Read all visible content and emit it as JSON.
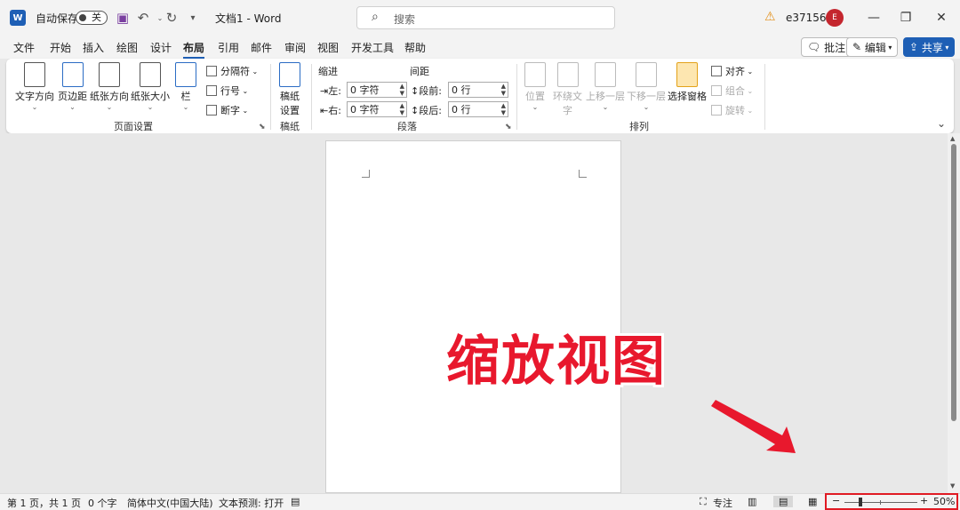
{
  "titlebar": {
    "autosave_label": "自动保存",
    "autosave_state": "关",
    "doc_title": "文档1 - Word",
    "search_placeholder": "搜索",
    "username": "e37156",
    "avatar_initial": "E"
  },
  "menu": [
    "文件",
    "开始",
    "插入",
    "绘图",
    "设计",
    "布局",
    "引用",
    "邮件",
    "审阅",
    "视图",
    "开发工具",
    "帮助"
  ],
  "menu_active": "布局",
  "right_buttons": {
    "comment": "批注",
    "edit": "编辑",
    "share": "共享"
  },
  "ribbon": {
    "page_setup": {
      "buttons": [
        "文字方向",
        "页边距",
        "纸张方向",
        "纸张大小",
        "栏"
      ],
      "small": [
        "分隔符",
        "行号",
        "断字"
      ],
      "label": "页面设置"
    },
    "draft": {
      "button_line1": "稿纸",
      "button_line2": "设置",
      "label": "稿纸"
    },
    "paragraph": {
      "indent_title": "缩进",
      "spacing_title": "间距",
      "left_label": "左:",
      "right_label": "右:",
      "left_value": "0 字符",
      "right_value": "0 字符",
      "before_label": "段前:",
      "after_label": "段后:",
      "before_value": "0 行",
      "after_value": "0 行",
      "label": "段落"
    },
    "arrange": {
      "position": "位置",
      "wrap_line1": "环绕文",
      "wrap_line2": "字",
      "forward": "上移一层",
      "backward": "下移一层",
      "pane": "选择窗格",
      "align": "对齐",
      "group": "组合",
      "rotate": "旋转",
      "label": "排列"
    }
  },
  "overlay_text": "缩放视图",
  "statusbar": {
    "page": "第 1 页，共 1 页",
    "words": "0 个字",
    "language": "简体中文(中国大陆)",
    "predict": "文本预测: 打开",
    "focus": "专注",
    "zoom_percent": "50%"
  },
  "zoom_level": 0.5,
  "colors": {
    "accent": "#1e5fb5",
    "highlight": "#e01b24",
    "overlay_text": "#e8182d"
  }
}
